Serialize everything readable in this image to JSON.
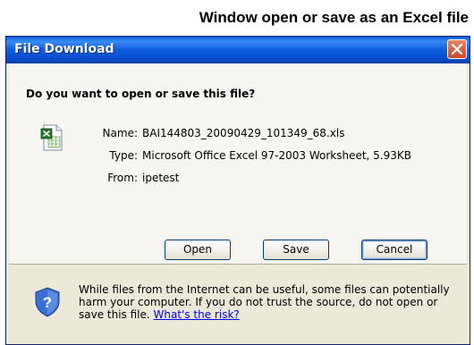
{
  "caption": "Window open or save as an Excel file",
  "dialog": {
    "title": "File Download",
    "question": "Do you want to open or save this file?",
    "file": {
      "name_label": "Name:",
      "name": "BAI144803_20090429_101349_68.xls",
      "type_label": "Type:",
      "type": "Microsoft Office Excel 97-2003 Worksheet, 5.93KB",
      "from_label": "From:",
      "from": "ipetest"
    },
    "buttons": {
      "open": "Open",
      "save": "Save",
      "cancel": "Cancel"
    },
    "warning": {
      "line1": "While files from the Internet can be useful, some files can potentially",
      "line2": "harm your computer. If you do not trust the source, do not open or",
      "line3": "save this file. ",
      "link": "What's the risk?"
    }
  },
  "icons": {
    "file": "excel-file-icon",
    "close": "close-icon",
    "security": "shield-question-icon"
  },
  "colors": {
    "titlebar": "#0a5bd4",
    "dialog_bg": "#ece9d8",
    "close_button": "#c94a24",
    "link": "#0000ee"
  }
}
